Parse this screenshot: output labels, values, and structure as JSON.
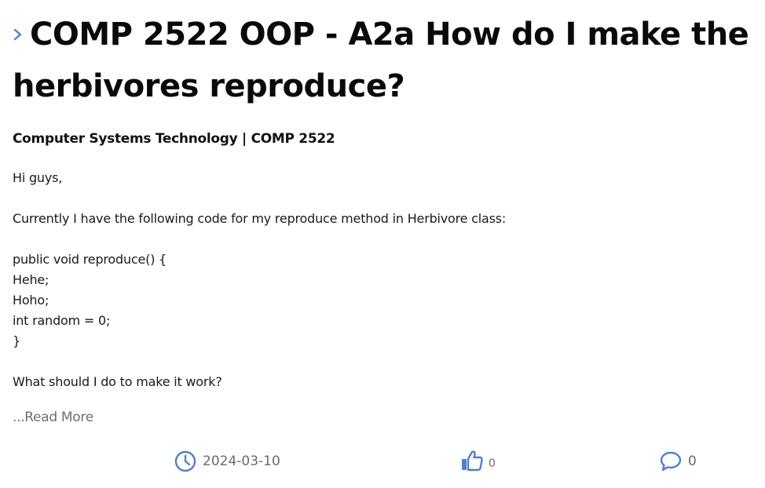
{
  "post": {
    "title": "COMP 2522 OOP - A2a How do I make the herbivores reproduce?",
    "category": "Computer Systems Technology | COMP 2522",
    "body_lines": [
      "Hi guys,",
      "",
      "Currently I have the following code for my reproduce method in Herbivore class:",
      "",
      "public void reproduce() {",
      "Hehe;",
      "Hoho;",
      "int random = 0;",
      "}",
      "",
      "What should I do to make it work?"
    ],
    "read_more_label": "...Read More"
  },
  "footer": {
    "date": "2024-03-10",
    "likes": "0",
    "comments": "0"
  },
  "icons": {
    "title_chevron": "chevron-right-icon",
    "date": "clock-icon",
    "likes": "thumbs-up-icon",
    "comments": "comment-bubble-icon"
  },
  "colors": {
    "accent": "#4a80d8",
    "muted_text": "#6a6a6a",
    "title_text": "#0a0a0a"
  }
}
